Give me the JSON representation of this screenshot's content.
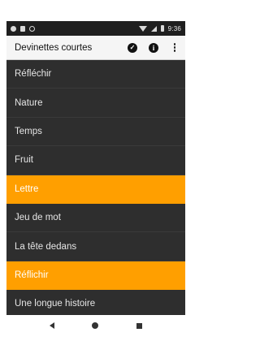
{
  "status_bar": {
    "time": "9:36",
    "icons": [
      "gear-icon",
      "sd-card-icon",
      "sync-circle-icon",
      "wifi-icon",
      "signal-icon",
      "battery-icon"
    ]
  },
  "app_bar": {
    "title": "Devinettes courtes",
    "actions": [
      "check-icon",
      "info-icon",
      "overflow-menu-icon"
    ]
  },
  "list": {
    "items": [
      {
        "label": "Réfléchir",
        "highlighted": false
      },
      {
        "label": "Nature",
        "highlighted": false
      },
      {
        "label": "Temps",
        "highlighted": false
      },
      {
        "label": "Fruit",
        "highlighted": false
      },
      {
        "label": "Lettre",
        "highlighted": true
      },
      {
        "label": "Jeu de mot",
        "highlighted": false
      },
      {
        "label": "La tête dedans",
        "highlighted": false
      },
      {
        "label": "Réflichir",
        "highlighted": true
      },
      {
        "label": "Une longue histoire",
        "highlighted": false
      }
    ]
  },
  "nav_bar": {
    "buttons": [
      "back-icon",
      "home-icon",
      "recents-icon"
    ]
  },
  "colors": {
    "highlight": "#ff9f00",
    "list_background": "#2e2e2e",
    "app_bar_background": "#f5f5f5"
  }
}
